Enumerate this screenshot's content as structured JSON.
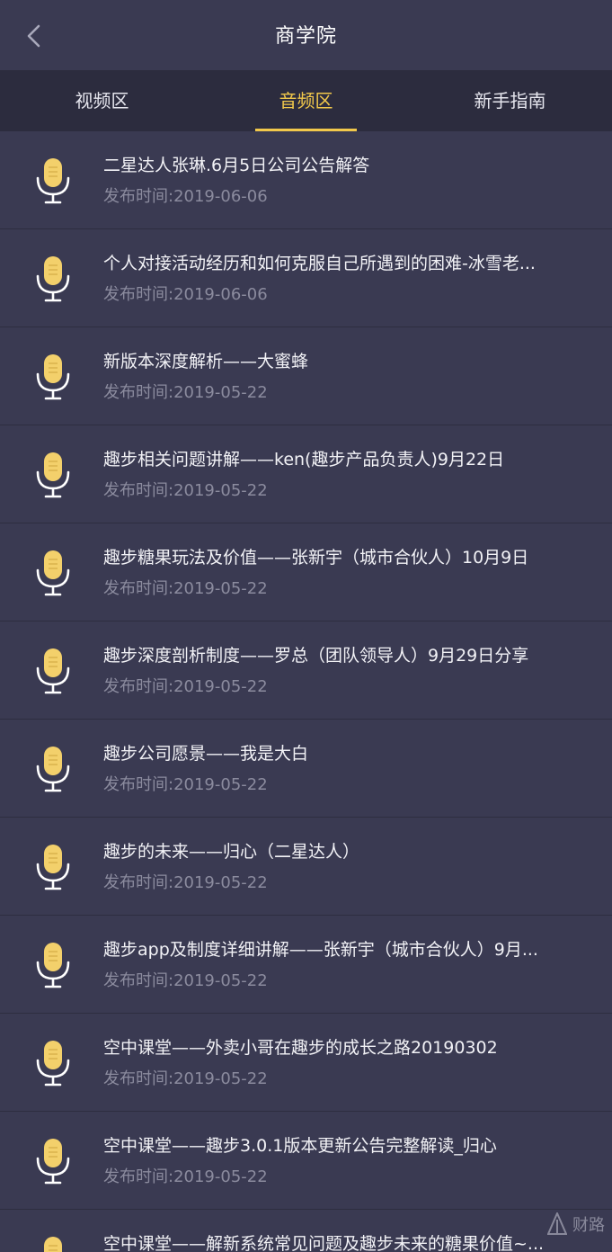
{
  "header": {
    "title": "商学院",
    "back_icon": "chevron-left-icon"
  },
  "tabs": [
    {
      "label": "视频区",
      "active": false
    },
    {
      "label": "音频区",
      "active": true
    },
    {
      "label": "新手指南",
      "active": false
    }
  ],
  "colors": {
    "accent": "#f1c84b",
    "background": "#3a3a52",
    "tab_bar": "#2c2c3e"
  },
  "list": {
    "item_icon": "microphone-icon",
    "items": [
      {
        "title": "二星达人张琳.6月5日公司公告解答",
        "date": "发布时间:2019-06-06"
      },
      {
        "title": "个人对接活动经历和如何克服自己所遇到的困难-冰雪老...",
        "date": "发布时间:2019-06-06"
      },
      {
        "title": "新版本深度解析——大蜜蜂",
        "date": "发布时间:2019-05-22"
      },
      {
        "title": "趣步相关问题讲解——ken(趣步产品负责人)9月22日",
        "date": "发布时间:2019-05-22"
      },
      {
        "title": "趣步糖果玩法及价值——张新宇（城市合伙人）10月9日",
        "date": "发布时间:2019-05-22"
      },
      {
        "title": "趣步深度剖析制度——罗总（团队领导人）9月29日分享",
        "date": "发布时间:2019-05-22"
      },
      {
        "title": "趣步公司愿景——我是大白",
        "date": "发布时间:2019-05-22"
      },
      {
        "title": "趣步的未来——归心（二星达人）",
        "date": "发布时间:2019-05-22"
      },
      {
        "title": "趣步app及制度详细讲解——张新宇（城市合伙人）9月...",
        "date": "发布时间:2019-05-22"
      },
      {
        "title": "空中课堂——外卖小哥在趣步的成长之路20190302",
        "date": "发布时间:2019-05-22"
      },
      {
        "title": "空中课堂——趣步3.0.1版本更新公告完整解读_归心",
        "date": "发布时间:2019-05-22"
      },
      {
        "title": "空中课堂——解新系统常见问题及趣步未来的糖果价值~...",
        "date": ""
      }
    ]
  },
  "watermark": {
    "text": "财路"
  }
}
